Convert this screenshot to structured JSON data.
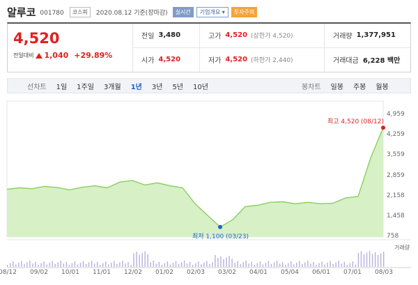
{
  "header": {
    "name": "알루코",
    "code": "001780",
    "market": "코스피",
    "date": "2020.08.12  기준(장마감)",
    "realtime": "실시간",
    "company_info": "기업개요 ▾",
    "warning": "투자주의"
  },
  "quote": {
    "price": "4,520",
    "change_label": "전일대비",
    "change": "1,040",
    "change_pct": "+29.89%",
    "prev_close_label": "전일",
    "prev_close": "3,480",
    "open_label": "시가",
    "open": "4,520",
    "high_label": "고가",
    "high": "4,520",
    "high_note": "(상한가 4,520)",
    "low_label": "저가",
    "low": "4,520",
    "low_note": "(하한가 2,440)",
    "volume_label": "거래량",
    "volume": "1,377,951",
    "value_label": "거래대금",
    "value": "6,228 백만"
  },
  "tabs": {
    "line_label": "선차트",
    "periods": [
      "1일",
      "1주일",
      "3개월",
      "1년",
      "3년",
      "5년",
      "10년"
    ],
    "active": "1년",
    "candle_label": "봉차트",
    "candles": [
      "일봉",
      "주봉",
      "월봉"
    ]
  },
  "colors": {
    "up": "#e02020",
    "low_marker": "#1e63c9",
    "line": "#88cf5e",
    "fill": "#d7f0c6",
    "volume": "#b7aedb"
  },
  "chart_data": {
    "type": "area",
    "title": "",
    "yticks": [
      "4,959",
      "4,259",
      "3,559",
      "2,859",
      "2,158",
      "1,458",
      "758"
    ],
    "ylim": [
      758,
      4959
    ],
    "xticks": [
      "08/12",
      "09/02",
      "10/01",
      "11/01",
      "12/02",
      "01/02",
      "02/03",
      "03/02",
      "04/01",
      "05/04",
      "06/01",
      "07/01",
      "08/03"
    ],
    "x": [
      "08/12",
      "08/26",
      "09/09",
      "09/23",
      "10/07",
      "10/21",
      "11/04",
      "11/18",
      "12/02",
      "12/16",
      "12/30",
      "01/13",
      "01/27",
      "02/10",
      "02/24",
      "03/09",
      "03/16",
      "03/23",
      "03/30",
      "04/13",
      "04/27",
      "05/11",
      "05/25",
      "06/08",
      "06/22",
      "07/06",
      "07/20",
      "08/03",
      "08/10",
      "08/11",
      "08/12"
    ],
    "series": [
      {
        "values": [
          2400,
          2450,
          2420,
          2500,
          2460,
          2380,
          2470,
          2520,
          2450,
          2650,
          2700,
          2550,
          2620,
          2520,
          2450,
          1900,
          1500,
          1100,
          1350,
          1800,
          1850,
          1950,
          1970,
          1900,
          1950,
          1900,
          1920,
          2100,
          2150,
          3480,
          4520
        ]
      }
    ],
    "annotations": {
      "high": "최고 4,520 (08/12)",
      "low": "최저 1,100 (03/23)"
    },
    "volume_legend": "거래량"
  }
}
